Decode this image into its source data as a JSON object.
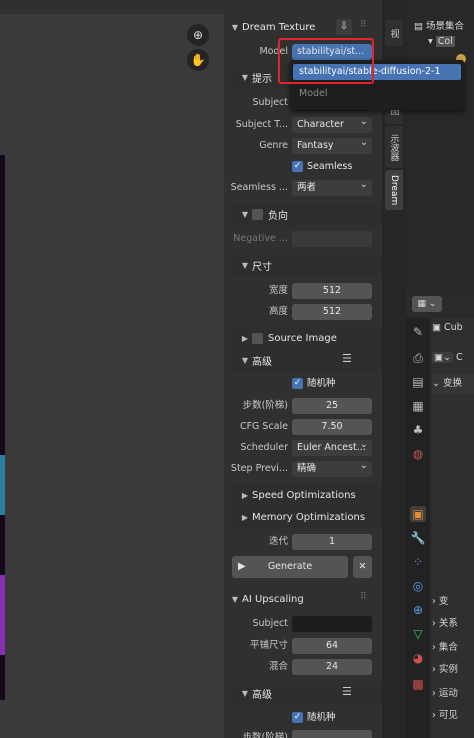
{
  "dream_texture": {
    "title": "Dream Texture",
    "model_label": "Model",
    "model_value": "stabilityai/st...",
    "prompt_label": "提示",
    "subject_label": "Subject",
    "subject_type_label": "Subject T...",
    "subject_type_value": "Character",
    "genre_label": "Genre",
    "genre_value": "Fantasy",
    "seamless_label": "Seamless",
    "seamless_axes_label": "Seamless ...",
    "seamless_axes_value": "两者",
    "negative_label": "负向",
    "negative_prompt_label": "Negative ...",
    "size_label": "尺寸",
    "width_label": "宽度",
    "width_value": "512",
    "height_label": "高度",
    "height_value": "512",
    "source_image_label": "Source Image",
    "advanced_label": "高级",
    "random_seed_label": "随机种",
    "steps_label": "步数(阶梯)",
    "steps_value": "25",
    "cfg_label": "CFG Scale",
    "cfg_value": "7.50",
    "scheduler_label": "Scheduler",
    "scheduler_value": "Euler Ancest...",
    "step_preview_label": "Step Previ...",
    "step_preview_value": "精确",
    "speed_opt_label": "Speed Optimizations",
    "memory_opt_label": "Memory Optimizations",
    "iterations_label": "迭代",
    "iterations_value": "1",
    "generate_label": "Generate",
    "close_label": "✕"
  },
  "ai_upscaling": {
    "title": "AI Upscaling",
    "subject_label": "Subject",
    "tile_size_label": "平铺尺寸",
    "tile_size_value": "64",
    "blend_label": "混合",
    "blend_value": "24",
    "advanced_label": "高级",
    "random_seed_label": "随机种",
    "steps_label": "步数(阶梯)"
  },
  "dropdown": {
    "selected_item": "stabilityai/stable-diffusion-2-1",
    "hint": "Model"
  },
  "vertical_tabs": [
    "视",
    "视图",
    "示波器",
    "Dream"
  ],
  "outliner": {
    "scene_collection": "场景集合",
    "collection": "Col"
  },
  "properties": {
    "object_name": "Cub",
    "object_name_2": "C",
    "transform": "变换",
    "delta_transform": "变",
    "relations": "关系",
    "collections": "集合",
    "instancing": "实例",
    "motion_paths": "运动",
    "visibility": "可见"
  },
  "colors": {
    "accent_blue": "#4772b3",
    "highlight_red": "#e0232d"
  }
}
